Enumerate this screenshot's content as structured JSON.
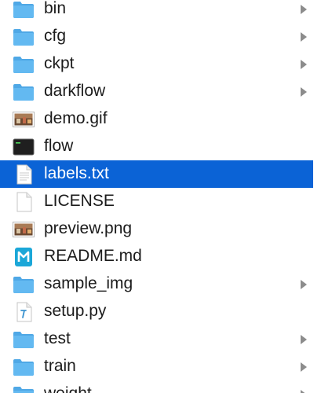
{
  "finder": {
    "items": [
      {
        "name": "bin",
        "kind": "folder",
        "has_children": true
      },
      {
        "name": "cfg",
        "kind": "folder",
        "has_children": true
      },
      {
        "name": "ckpt",
        "kind": "folder",
        "has_children": true
      },
      {
        "name": "darkflow",
        "kind": "folder",
        "has_children": true
      },
      {
        "name": "demo.gif",
        "kind": "image",
        "has_children": false
      },
      {
        "name": "flow",
        "kind": "terminal",
        "has_children": false
      },
      {
        "name": "labels.txt",
        "kind": "text",
        "has_children": false,
        "selected": true
      },
      {
        "name": "LICENSE",
        "kind": "document",
        "has_children": false
      },
      {
        "name": "preview.png",
        "kind": "image",
        "has_children": false
      },
      {
        "name": "README.md",
        "kind": "markdown",
        "has_children": false
      },
      {
        "name": "sample_img",
        "kind": "folder",
        "has_children": true
      },
      {
        "name": "setup.py",
        "kind": "python",
        "has_children": false
      },
      {
        "name": "test",
        "kind": "folder",
        "has_children": true
      },
      {
        "name": "train",
        "kind": "folder",
        "has_children": true
      },
      {
        "name": "weight",
        "kind": "folder",
        "has_children": true
      }
    ]
  },
  "colors": {
    "selection": "#0b63d6",
    "folder": "#63b9f1",
    "chevron": "#8c8c8c"
  },
  "icons": {
    "folder": "folder-icon",
    "image": "image-file-icon",
    "terminal": "terminal-executable-icon",
    "text": "text-file-icon",
    "document": "document-icon",
    "markdown": "markdown-file-icon",
    "python": "python-file-icon"
  }
}
